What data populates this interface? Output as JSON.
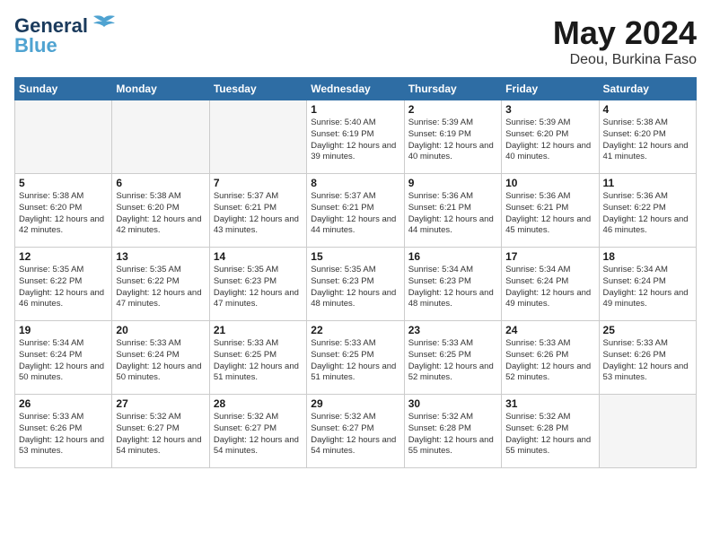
{
  "header": {
    "logo_line1": "General",
    "logo_line2": "Blue",
    "month": "May 2024",
    "location": "Deou, Burkina Faso"
  },
  "weekdays": [
    "Sunday",
    "Monday",
    "Tuesday",
    "Wednesday",
    "Thursday",
    "Friday",
    "Saturday"
  ],
  "weeks": [
    [
      {
        "day": "",
        "info": ""
      },
      {
        "day": "",
        "info": ""
      },
      {
        "day": "",
        "info": ""
      },
      {
        "day": "1",
        "info": "Sunrise: 5:40 AM\nSunset: 6:19 PM\nDaylight: 12 hours\nand 39 minutes."
      },
      {
        "day": "2",
        "info": "Sunrise: 5:39 AM\nSunset: 6:19 PM\nDaylight: 12 hours\nand 40 minutes."
      },
      {
        "day": "3",
        "info": "Sunrise: 5:39 AM\nSunset: 6:20 PM\nDaylight: 12 hours\nand 40 minutes."
      },
      {
        "day": "4",
        "info": "Sunrise: 5:38 AM\nSunset: 6:20 PM\nDaylight: 12 hours\nand 41 minutes."
      }
    ],
    [
      {
        "day": "5",
        "info": "Sunrise: 5:38 AM\nSunset: 6:20 PM\nDaylight: 12 hours\nand 42 minutes."
      },
      {
        "day": "6",
        "info": "Sunrise: 5:38 AM\nSunset: 6:20 PM\nDaylight: 12 hours\nand 42 minutes."
      },
      {
        "day": "7",
        "info": "Sunrise: 5:37 AM\nSunset: 6:21 PM\nDaylight: 12 hours\nand 43 minutes."
      },
      {
        "day": "8",
        "info": "Sunrise: 5:37 AM\nSunset: 6:21 PM\nDaylight: 12 hours\nand 44 minutes."
      },
      {
        "day": "9",
        "info": "Sunrise: 5:36 AM\nSunset: 6:21 PM\nDaylight: 12 hours\nand 44 minutes."
      },
      {
        "day": "10",
        "info": "Sunrise: 5:36 AM\nSunset: 6:21 PM\nDaylight: 12 hours\nand 45 minutes."
      },
      {
        "day": "11",
        "info": "Sunrise: 5:36 AM\nSunset: 6:22 PM\nDaylight: 12 hours\nand 46 minutes."
      }
    ],
    [
      {
        "day": "12",
        "info": "Sunrise: 5:35 AM\nSunset: 6:22 PM\nDaylight: 12 hours\nand 46 minutes."
      },
      {
        "day": "13",
        "info": "Sunrise: 5:35 AM\nSunset: 6:22 PM\nDaylight: 12 hours\nand 47 minutes."
      },
      {
        "day": "14",
        "info": "Sunrise: 5:35 AM\nSunset: 6:23 PM\nDaylight: 12 hours\nand 47 minutes."
      },
      {
        "day": "15",
        "info": "Sunrise: 5:35 AM\nSunset: 6:23 PM\nDaylight: 12 hours\nand 48 minutes."
      },
      {
        "day": "16",
        "info": "Sunrise: 5:34 AM\nSunset: 6:23 PM\nDaylight: 12 hours\nand 48 minutes."
      },
      {
        "day": "17",
        "info": "Sunrise: 5:34 AM\nSunset: 6:24 PM\nDaylight: 12 hours\nand 49 minutes."
      },
      {
        "day": "18",
        "info": "Sunrise: 5:34 AM\nSunset: 6:24 PM\nDaylight: 12 hours\nand 49 minutes."
      }
    ],
    [
      {
        "day": "19",
        "info": "Sunrise: 5:34 AM\nSunset: 6:24 PM\nDaylight: 12 hours\nand 50 minutes."
      },
      {
        "day": "20",
        "info": "Sunrise: 5:33 AM\nSunset: 6:24 PM\nDaylight: 12 hours\nand 50 minutes."
      },
      {
        "day": "21",
        "info": "Sunrise: 5:33 AM\nSunset: 6:25 PM\nDaylight: 12 hours\nand 51 minutes."
      },
      {
        "day": "22",
        "info": "Sunrise: 5:33 AM\nSunset: 6:25 PM\nDaylight: 12 hours\nand 51 minutes."
      },
      {
        "day": "23",
        "info": "Sunrise: 5:33 AM\nSunset: 6:25 PM\nDaylight: 12 hours\nand 52 minutes."
      },
      {
        "day": "24",
        "info": "Sunrise: 5:33 AM\nSunset: 6:26 PM\nDaylight: 12 hours\nand 52 minutes."
      },
      {
        "day": "25",
        "info": "Sunrise: 5:33 AM\nSunset: 6:26 PM\nDaylight: 12 hours\nand 53 minutes."
      }
    ],
    [
      {
        "day": "26",
        "info": "Sunrise: 5:33 AM\nSunset: 6:26 PM\nDaylight: 12 hours\nand 53 minutes."
      },
      {
        "day": "27",
        "info": "Sunrise: 5:32 AM\nSunset: 6:27 PM\nDaylight: 12 hours\nand 54 minutes."
      },
      {
        "day": "28",
        "info": "Sunrise: 5:32 AM\nSunset: 6:27 PM\nDaylight: 12 hours\nand 54 minutes."
      },
      {
        "day": "29",
        "info": "Sunrise: 5:32 AM\nSunset: 6:27 PM\nDaylight: 12 hours\nand 54 minutes."
      },
      {
        "day": "30",
        "info": "Sunrise: 5:32 AM\nSunset: 6:28 PM\nDaylight: 12 hours\nand 55 minutes."
      },
      {
        "day": "31",
        "info": "Sunrise: 5:32 AM\nSunset: 6:28 PM\nDaylight: 12 hours\nand 55 minutes."
      },
      {
        "day": "",
        "info": ""
      }
    ]
  ]
}
